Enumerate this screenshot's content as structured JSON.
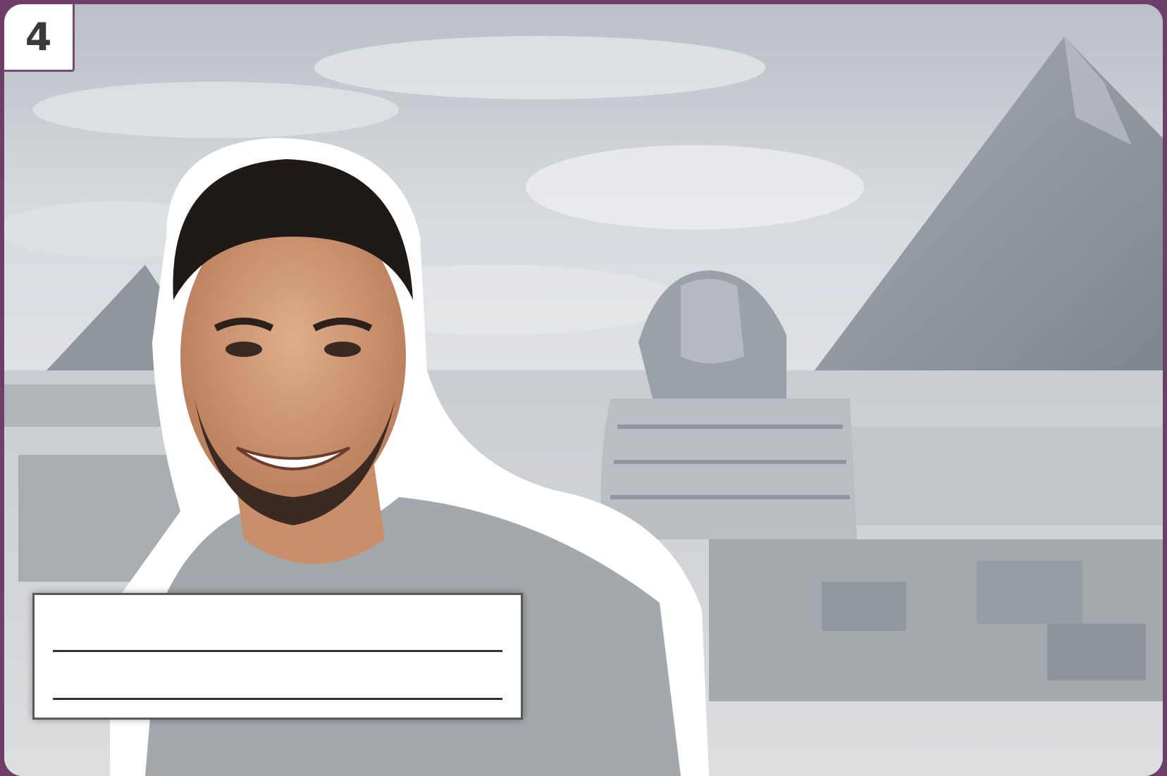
{
  "card": {
    "number": "4",
    "background_color": "#6e3d6a"
  },
  "scene": {
    "background_photo": "giza-pyramids-sphinx-grayscale",
    "foreground_photo": "smiling-man-cutout"
  },
  "answer_box": {
    "line_count": 2
  }
}
